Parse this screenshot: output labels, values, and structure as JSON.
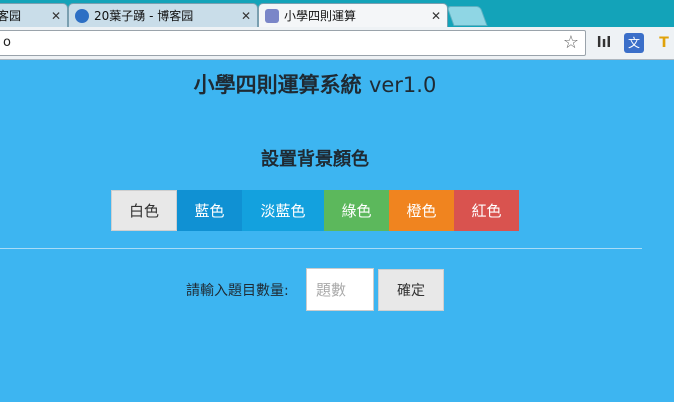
{
  "browser": {
    "tabs": [
      {
        "label": "客园",
        "close": "✕"
      },
      {
        "label": "20葉子踴 - 博客园",
        "close": "✕"
      },
      {
        "label": "小學四則運算",
        "close": "✕"
      }
    ],
    "address": "o",
    "star_glyph": "☆",
    "ext_stats_glyph": "lıl",
    "ext_translate_glyph": "文",
    "ext_other_glyph": "T"
  },
  "page": {
    "title": "小學四則運算系統",
    "version": "ver1.0",
    "bg_section_title": "設置背景顏色",
    "color_buttons": [
      "白色",
      "藍色",
      "淡藍色",
      "綠色",
      "橙色",
      "紅色"
    ],
    "input_label": "請輸入題目數量:",
    "input_placeholder": "題數",
    "input_value": "",
    "confirm_label": "確定"
  },
  "colors": {
    "page_bg": "#3db5f1",
    "white": "#e8e8e8",
    "blue": "#1091d3",
    "light_blue": "#13a1de",
    "green": "#5cb85c",
    "orange": "#f0841f",
    "red": "#d9534f"
  }
}
